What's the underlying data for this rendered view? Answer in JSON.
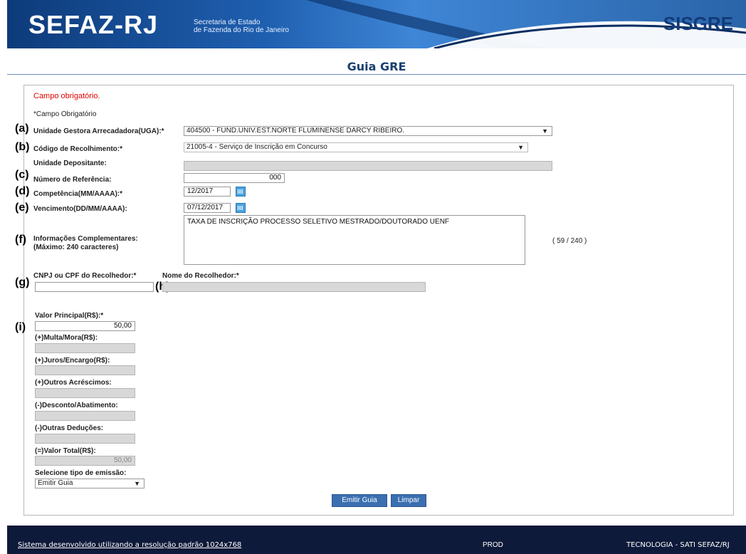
{
  "header": {
    "logo": "SEFAZ-RJ",
    "subtitle_1": "Secretaria de Estado",
    "subtitle_2": "de Fazenda do Rio de Janeiro",
    "system": "SISGRE"
  },
  "page_title": "Guia GRE",
  "form": {
    "required_message": "Campo obrigatório.",
    "required_note": "*Campo Obrigatório",
    "uga": {
      "label": "Unidade Gestora Arrecadadora(UGA):*",
      "value": "404500 - FUND.UNIV.EST.NORTE FLUMINENSE DARCY RIBEIRO."
    },
    "codigo": {
      "label": "Código de Recolhimento:*",
      "value": "21005-4 - Serviço de Inscrição em Concurso"
    },
    "depositante": {
      "label": "Unidade Depositante:",
      "value": ""
    },
    "referencia": {
      "label": "Número de Referência:",
      "value": "000"
    },
    "competencia": {
      "label": "Competência(MM/AAAA):*",
      "value": "12/2017"
    },
    "vencimento": {
      "label": "Vencimento(DD/MM/AAAA):",
      "value": "07/12/2017"
    },
    "info": {
      "label_1": "Informações Complementares:",
      "label_2": "(Máximo: 240 caracteres)",
      "value": "TAXA DE INSCRIÇÃO PROCESSO SELETIVO MESTRADO/DOUTORADO UENF",
      "counter": "( 59 / 240 )"
    },
    "cnpj": {
      "label": "CNPJ ou CPF do Recolhedor:*",
      "value": ""
    },
    "nome": {
      "label": "Nome do Recolhedor:*",
      "value": ""
    },
    "valor_principal": {
      "label": "Valor Principal(R$):*",
      "value": "50,00"
    },
    "multa": {
      "label": "(+)Multa/Mora(R$):",
      "value": ""
    },
    "juros": {
      "label": "(+)Juros/Encargo(R$):",
      "value": ""
    },
    "outros_acrescimos": {
      "label": "(+)Outros Acréscimos:",
      "value": ""
    },
    "desconto": {
      "label": "(-)Desconto/Abatimento:",
      "value": ""
    },
    "outras_deducoes": {
      "label": "(-)Outras Deduções:",
      "value": ""
    },
    "valor_total": {
      "label": "(=)Valor Total(R$):",
      "value": "50,00"
    },
    "emissao": {
      "label": "Selecione tipo de emissão:",
      "value": "Emitir Guia"
    },
    "btn_emitir": "Emitir Guia",
    "btn_limpar": "Limpar"
  },
  "markers": {
    "a": "(a)",
    "b": "(b)",
    "c": "(c)",
    "d": "(d)",
    "e": "(e)",
    "f": "(f)",
    "g": "(g)",
    "h": "(h)",
    "i": "(i)"
  },
  "footer": {
    "left": "Sistema desenvolvido utilizando a resolução padrão 1024x768",
    "center": "PROD",
    "right": "TECNOLOGIA - SATI SEFAZ/RJ"
  },
  "colors": {
    "header_blue": "#1f5fb0",
    "footer_navy": "#0e1a3a",
    "required_red": "#e00000",
    "button_blue": "#3b6fb0"
  }
}
